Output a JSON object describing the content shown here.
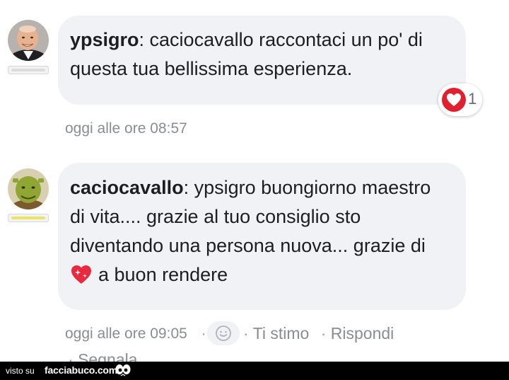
{
  "comments": [
    {
      "author": "ypsigro",
      "text_line1": ": caciocavallo raccontaci un po' di",
      "text_line2": "questa tua bellissima esperienza.",
      "timestamp": "oggi alle ore 08:57",
      "reaction": {
        "icon": "heart-icon",
        "count": "1",
        "color": "#e0202e"
      },
      "avatar_icon": "man-avatar"
    },
    {
      "author": "caciocavallo",
      "text_line1": ": ypsigro buongiorno maestro",
      "text_line2": "di vita.... grazie al tuo consiglio sto",
      "text_line3": "diventando una persona nuova... grazie di",
      "text_line4": "a buon rendere",
      "inline_emoji": "sparkling-heart-icon",
      "timestamp": "oggi alle ore 09:05",
      "actions": {
        "separator": "·",
        "smiley_icon": "smiley-icon",
        "ti_stimo": "Ti stimo",
        "rispondi": "Rispondi",
        "segnala": "Segnala"
      },
      "avatar_icon": "ogre-avatar"
    }
  ],
  "footer": {
    "visto_su": "visto su",
    "brand": "facciabuco.com",
    "mascot_icon": "eyes-icon"
  },
  "colors": {
    "bubble": "#f0f2f5",
    "text": "#1c1e21",
    "meta": "#8a8d91",
    "heart": "#e0202e",
    "rank_yellow": "#ece46a"
  }
}
